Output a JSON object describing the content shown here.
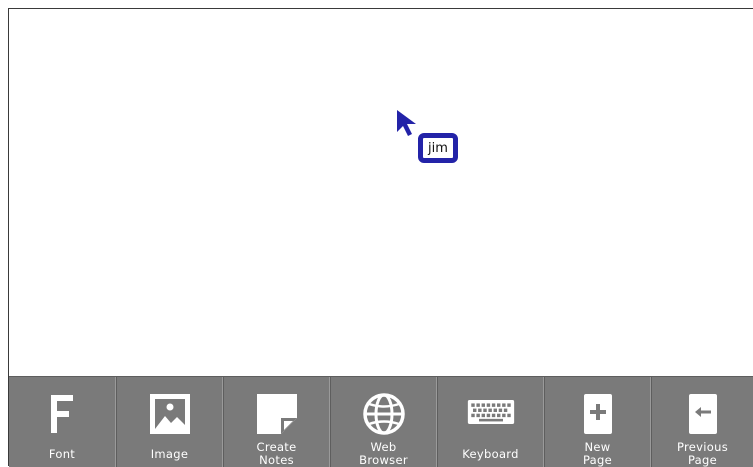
{
  "canvas": {
    "remote_user": "jim",
    "cursor_color": "#2323a8"
  },
  "toolbar": {
    "background": "#7a7a7a",
    "tools": [
      {
        "icon": "font-icon",
        "line1": "Font",
        "line2": ""
      },
      {
        "icon": "image-icon",
        "line1": "Image",
        "line2": ""
      },
      {
        "icon": "notes-icon",
        "line1": "Create",
        "line2": "Notes"
      },
      {
        "icon": "globe-icon",
        "line1": "Web",
        "line2": "Browser"
      },
      {
        "icon": "keyboard-icon",
        "line1": "Keyboard",
        "line2": ""
      },
      {
        "icon": "new-page-icon",
        "line1": "New",
        "line2": "Page"
      },
      {
        "icon": "previous-page-icon",
        "line1": "Previous",
        "line2": "Page"
      }
    ]
  }
}
